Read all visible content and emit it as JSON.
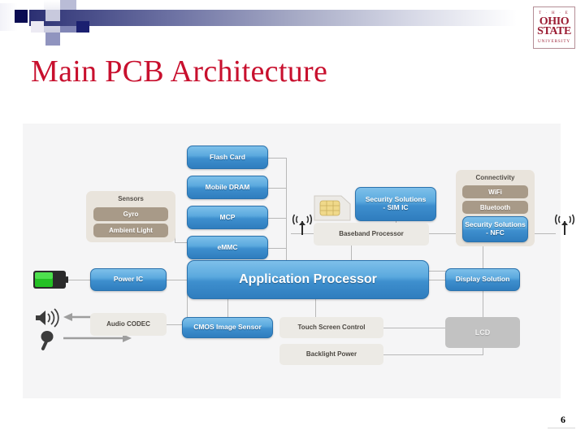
{
  "logo": {
    "the": "T · H · E",
    "ohio": "OHIO",
    "state": "STATE",
    "university": "UNIVERSITY",
    "color": "#9a1b32"
  },
  "slide": {
    "title": "Main PCB Architecture",
    "title_color": "#c8102e",
    "page_number": "6"
  },
  "diagram": {
    "accent_blue": "#3e8fce",
    "group_beige": "#e9e4dc",
    "tan_item": "#a89a88",
    "lcd_grey": "#c2c2c2",
    "memory_stack": [
      {
        "label": "Flash Card"
      },
      {
        "label": "Mobile DRAM"
      },
      {
        "label": "MCP"
      },
      {
        "label": "eMMC"
      }
    ],
    "sensors_group": {
      "title": "Sensors",
      "items": [
        {
          "label": "Gyro"
        },
        {
          "label": "Ambient Light"
        }
      ]
    },
    "connectivity_group": {
      "title": "Connectivity",
      "items": [
        {
          "label": "WiFi"
        },
        {
          "label": "Bluetooth"
        }
      ],
      "nfc": "Security Solutions\n- NFC",
      "nfc_line1": "Security Solutions",
      "nfc_line2": "- NFC"
    },
    "sim": {
      "line1": "Security Solutions",
      "line2": "- SIM IC"
    },
    "baseband": "Baseband Processor",
    "application_processor": "Application Processor",
    "power_ic": "Power IC",
    "audio_codec": "Audio CODEC",
    "cmos_image_sensor": "CMOS Image Sensor",
    "touch_screen_control": "Touch Screen Control",
    "backlight_power": "Backlight Power",
    "display_solution": "Display Solution",
    "lcd": "LCD",
    "icons": {
      "sim_card": "sim-card-icon",
      "antenna_left": "antenna-icon",
      "antenna_right": "antenna-icon",
      "battery": "battery-icon",
      "speaker": "speaker-icon",
      "microphone": "microphone-icon"
    }
  }
}
